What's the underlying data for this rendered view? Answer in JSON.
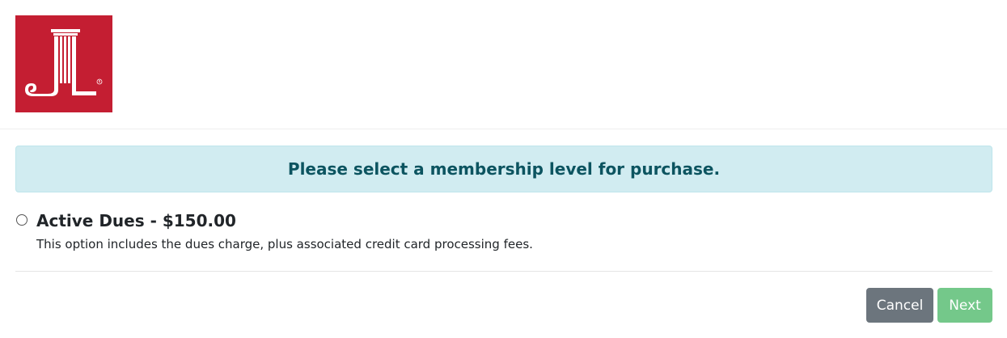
{
  "header": {
    "logo_icon": "junior-league-logo-icon",
    "logo_color": "#c41e32"
  },
  "alert": {
    "message": "Please select a membership level for purchase.",
    "background": "#d1ecf1",
    "text_color": "#0c5460"
  },
  "options": [
    {
      "title": "Active Dues - $150.00",
      "description": "This option includes the dues charge, plus associated credit card processing fees.",
      "selected": false
    }
  ],
  "actions": {
    "cancel_label": "Cancel",
    "next_label": "Next",
    "cancel_color": "#6c757d",
    "next_color": "#74c88a"
  }
}
